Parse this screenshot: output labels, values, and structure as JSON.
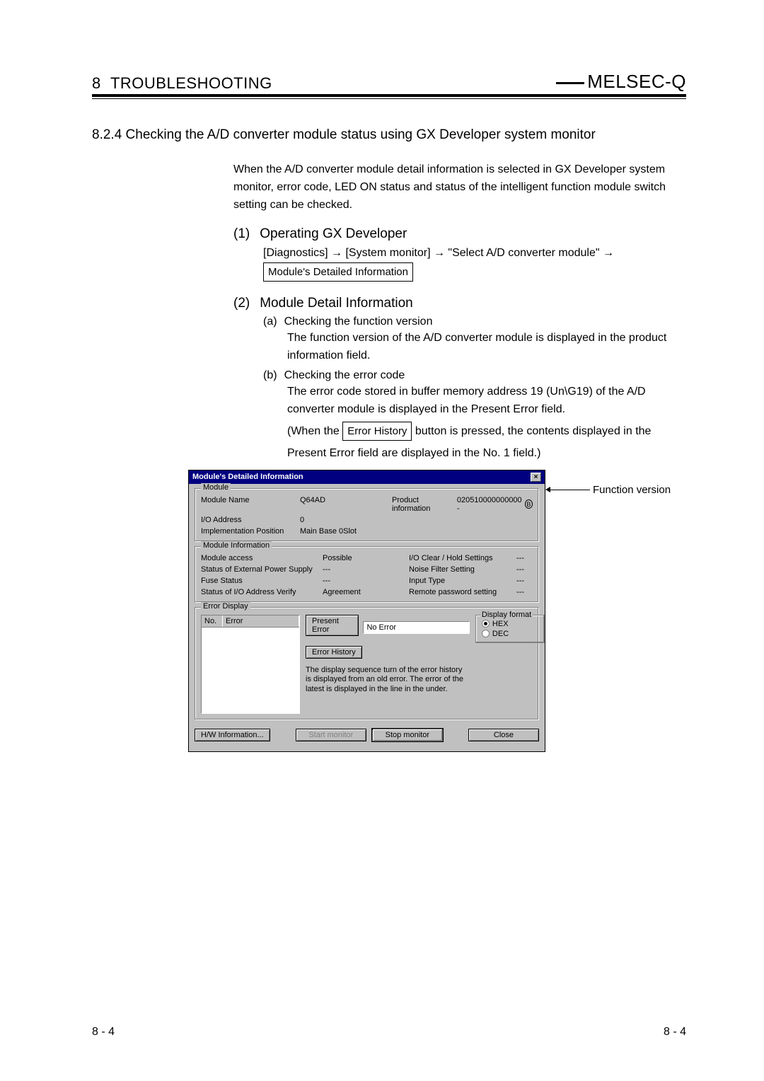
{
  "header": {
    "chapter": "8",
    "chapter_title": "TROUBLESHOOTING",
    "brand": "MELSEC-Q"
  },
  "section": {
    "number": "8.2.4",
    "title": "Checking the A/D converter module status using GX Developer system monitor"
  },
  "intro": "When the A/D converter module detail information is selected in GX Developer system monitor, error code, LED ON status and status of the intelligent function module switch setting can be checked.",
  "steps": [
    {
      "num": "(1)",
      "title": "Operating GX Developer",
      "body_pre": "[Diagnostics] → [System monitor] → \"Select A/D converter module\" →",
      "button": "Module's Detailed Information"
    },
    {
      "num": "(2)",
      "title": "Module Detail Information",
      "subs": [
        {
          "label": "(a)",
          "title": "Checking the function version",
          "body": "The function version of the A/D converter module is displayed in the product information field."
        },
        {
          "label": "(b)",
          "title": "Checking the error code",
          "body1": "The error code stored in buffer memory address 19 (Un\\G19) of the A/D converter module is displayed in the Present Error field.",
          "body2_pre": "(When the ",
          "body2_btn": "Error History",
          "body2_post": " button is pressed, the contents displayed in the",
          "body3": "Present Error field are displayed in the No. 1 field.)"
        }
      ]
    }
  ],
  "dialog": {
    "title": "Module's Detailed Information",
    "close": "×",
    "module": {
      "legend": "Module",
      "rows": {
        "name_label": "Module Name",
        "name_value": "Q64AD",
        "prodinfo_label": "Product information",
        "prodinfo_value": "020510000000000 -",
        "circle": "B",
        "io_label": "I/O Address",
        "io_value": "0",
        "impl_label": "Implementation Position",
        "impl_value": "Main Base  0Slot"
      }
    },
    "info": {
      "legend": "Module Information",
      "rows": {
        "access_label": "Module access",
        "access_value": "Possible",
        "ioclear_label": "I/O Clear / Hold Settings",
        "ioclear_value": "---",
        "extpwr_label": "Status of External Power Supply",
        "extpwr_value": "---",
        "noise_label": "Noise Filter Setting",
        "noise_value": "---",
        "fuse_label": "Fuse Status",
        "fuse_value": "---",
        "inputtype_label": "Input Type",
        "inputtype_value": "---",
        "ioverify_label": "Status of I/O Address Verify",
        "ioverify_value": "Agreement",
        "remote_label": "Remote password setting",
        "remote_value": "---"
      }
    },
    "error": {
      "legend": "Error Display",
      "list_head_no": "No.",
      "list_head_err": "Error",
      "present_label": "Present Error",
      "present_value": "No Error",
      "history_btn": "Error History",
      "note": "The display sequence turn of the error history is displayed from an old error. The error of the latest is displayed in the line in the under.",
      "display_format": {
        "legend": "Display format",
        "hex": "HEX",
        "dec": "DEC"
      }
    },
    "bottom": {
      "hw": "H/W Information...",
      "start": "Start monitor",
      "stop": "Stop monitor",
      "close": "Close"
    }
  },
  "callout": "Function version",
  "footer": {
    "left": "8 - 4",
    "right": "8 - 4"
  }
}
